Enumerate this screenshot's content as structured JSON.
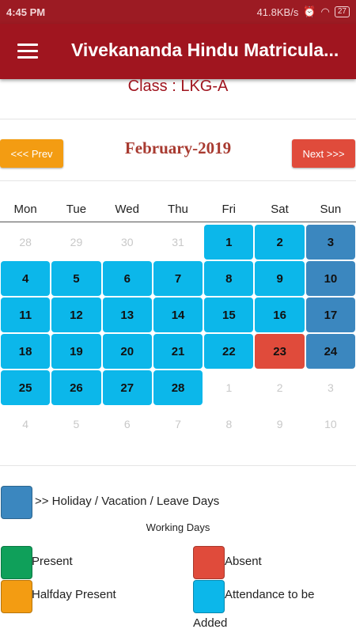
{
  "status_bar": {
    "time": "4:45 PM",
    "network_speed": "41.8KB/s",
    "battery": "27"
  },
  "app_bar": {
    "title": "Vivekananda Hindu Matricula...",
    "menu_icon": "hamburger-menu-icon"
  },
  "class_label": "Class : LKG-A",
  "navigation": {
    "prev_label": "<<< Prev",
    "next_label": "Next >>>",
    "month_label": "February-2019"
  },
  "weekdays": [
    "Mon",
    "Tue",
    "Wed",
    "Thu",
    "Fri",
    "Sat",
    "Sun"
  ],
  "calendar": {
    "weeks": [
      [
        {
          "day": "28",
          "status": "other-month"
        },
        {
          "day": "29",
          "status": "other-month"
        },
        {
          "day": "30",
          "status": "other-month"
        },
        {
          "day": "31",
          "status": "other-month"
        },
        {
          "day": "1",
          "status": "pending"
        },
        {
          "day": "2",
          "status": "pending"
        },
        {
          "day": "3",
          "status": "holiday"
        }
      ],
      [
        {
          "day": "4",
          "status": "pending"
        },
        {
          "day": "5",
          "status": "pending"
        },
        {
          "day": "6",
          "status": "pending"
        },
        {
          "day": "7",
          "status": "pending"
        },
        {
          "day": "8",
          "status": "pending"
        },
        {
          "day": "9",
          "status": "pending"
        },
        {
          "day": "10",
          "status": "holiday"
        }
      ],
      [
        {
          "day": "11",
          "status": "pending"
        },
        {
          "day": "12",
          "status": "pending"
        },
        {
          "day": "13",
          "status": "pending"
        },
        {
          "day": "14",
          "status": "pending"
        },
        {
          "day": "15",
          "status": "pending"
        },
        {
          "day": "16",
          "status": "pending"
        },
        {
          "day": "17",
          "status": "holiday"
        }
      ],
      [
        {
          "day": "18",
          "status": "pending"
        },
        {
          "day": "19",
          "status": "pending"
        },
        {
          "day": "20",
          "status": "pending"
        },
        {
          "day": "21",
          "status": "pending"
        },
        {
          "day": "22",
          "status": "pending"
        },
        {
          "day": "23",
          "status": "absent"
        },
        {
          "day": "24",
          "status": "holiday"
        }
      ],
      [
        {
          "day": "25",
          "status": "pending"
        },
        {
          "day": "26",
          "status": "pending"
        },
        {
          "day": "27",
          "status": "pending"
        },
        {
          "day": "28",
          "status": "pending"
        },
        {
          "day": "1",
          "status": "other-month"
        },
        {
          "day": "2",
          "status": "other-month"
        },
        {
          "day": "3",
          "status": "other-month"
        }
      ],
      [
        {
          "day": "4",
          "status": "other-month"
        },
        {
          "day": "5",
          "status": "other-month"
        },
        {
          "day": "6",
          "status": "other-month"
        },
        {
          "day": "7",
          "status": "other-month"
        },
        {
          "day": "8",
          "status": "other-month"
        },
        {
          "day": "9",
          "status": "other-month"
        },
        {
          "day": "10",
          "status": "other-month"
        }
      ]
    ]
  },
  "legend": {
    "holiday": {
      "label": ">> Holiday / Vacation / Leave Days",
      "color": "#3b87bf"
    },
    "working_days_title": "Working Days",
    "present": {
      "label": "Present",
      "color": "#0fa05a"
    },
    "absent": {
      "label": "Absent",
      "color": "#e04b3b"
    },
    "halfday": {
      "label": "Halfday Present",
      "color": "#f39c12"
    },
    "pending": {
      "label_line1": "Attendance to be",
      "label_line2": "Added",
      "color": "#0cb7ea"
    }
  }
}
